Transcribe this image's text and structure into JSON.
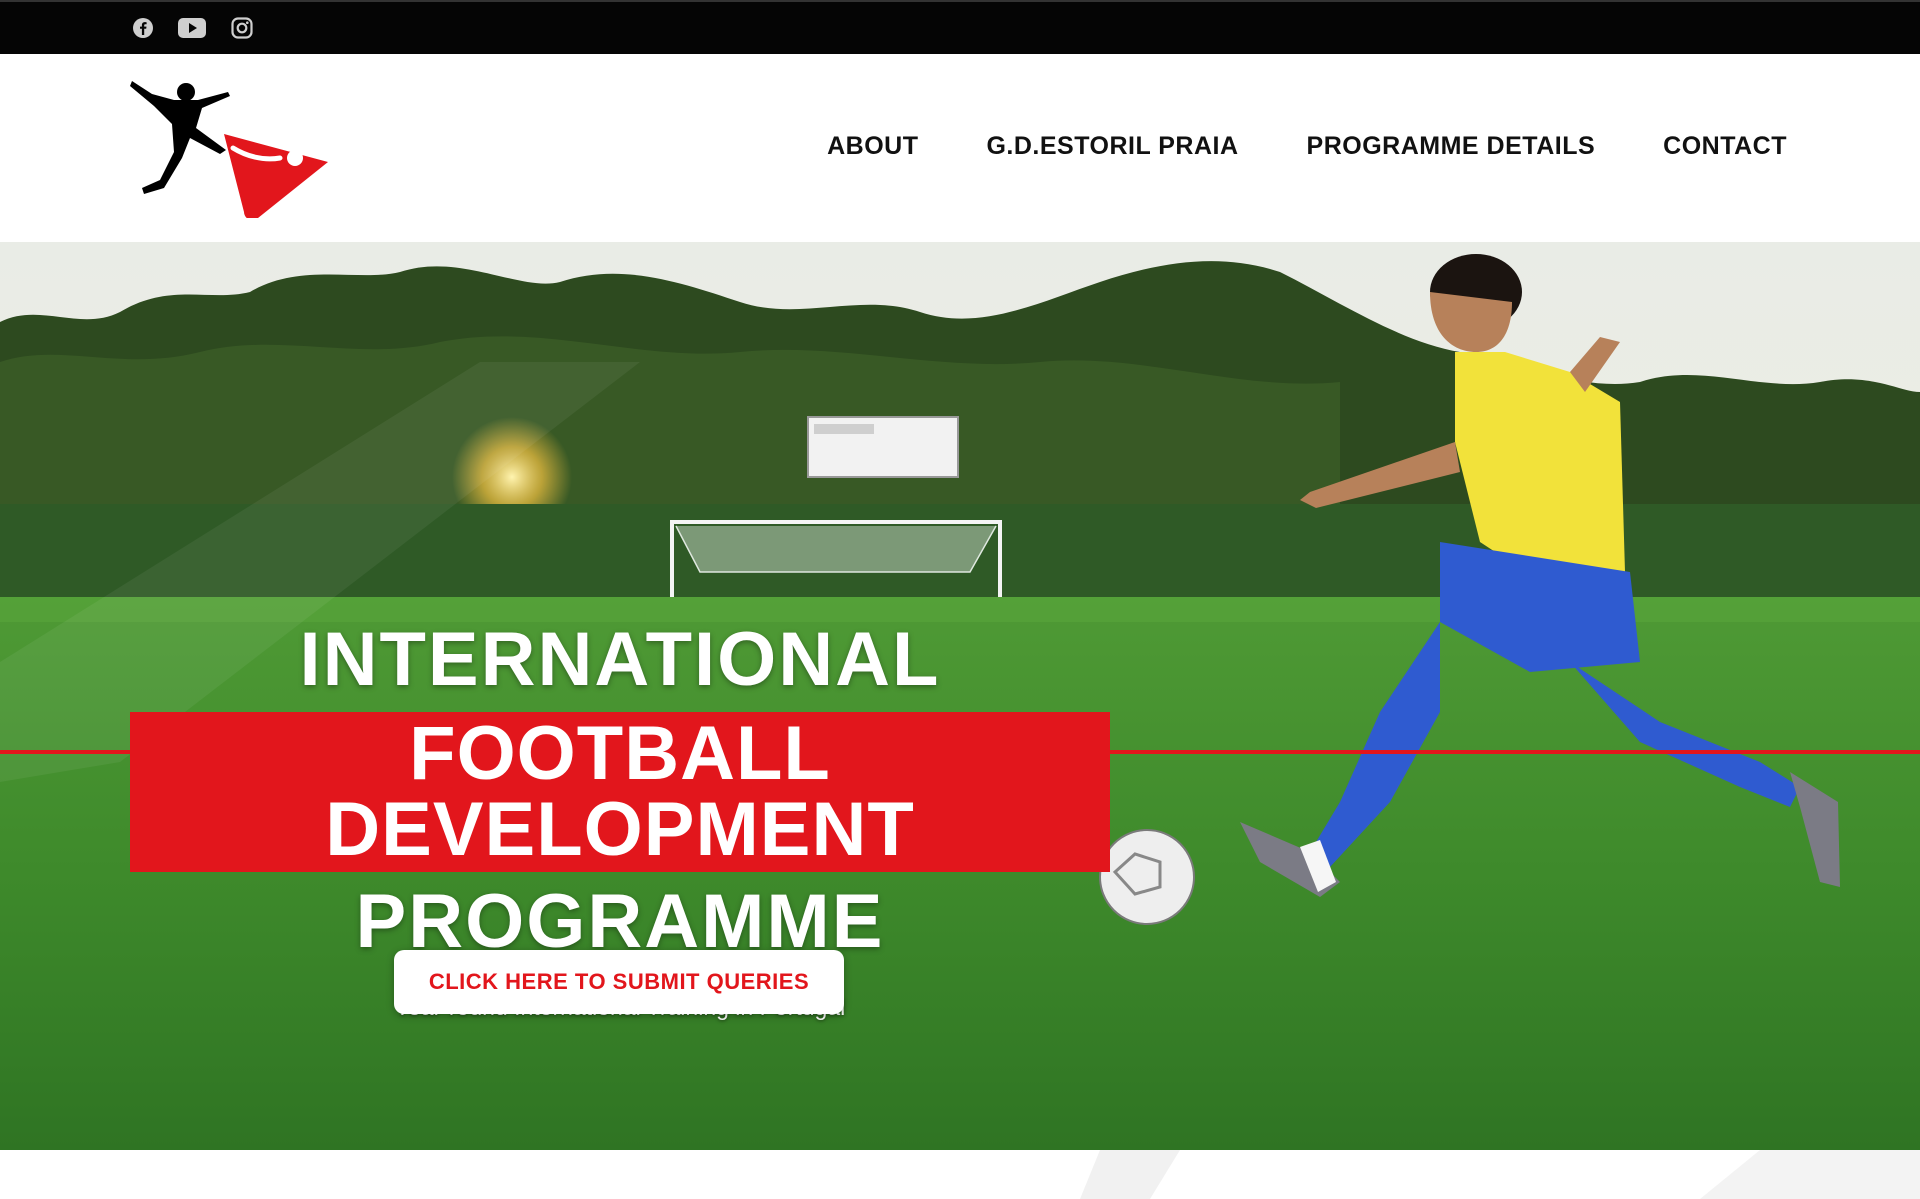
{
  "social": {
    "facebook_icon": "facebook-icon",
    "youtube_icon": "youtube-icon",
    "instagram_icon": "instagram-icon"
  },
  "nav": {
    "items": [
      {
        "label": "ABOUT"
      },
      {
        "label": "G.D.ESTORIL PRAIA"
      },
      {
        "label": "PROGRAMME DETAILS"
      },
      {
        "label": "CONTACT"
      }
    ]
  },
  "hero": {
    "line1": "INTERNATIONAL",
    "line2": "FOOTBALL DEVELOPMENT",
    "line3": "PROGRAMME",
    "subtitle": "Year-round International Training in Portugal",
    "cta_label": "CLICK HERE TO SUBMIT QUERIES"
  },
  "colors": {
    "accent_red": "#e2161c",
    "topbar": "#050505",
    "grass": "#3f8f2f"
  }
}
